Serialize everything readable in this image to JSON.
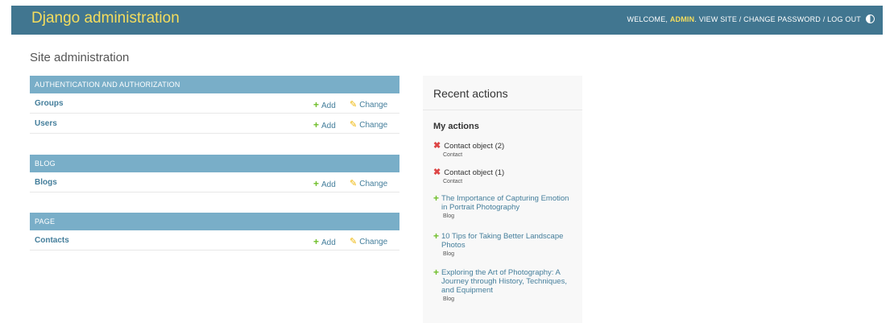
{
  "header": {
    "brand": "Django administration",
    "welcome": "WELCOME,",
    "username": "ADMIN",
    "view_site": "VIEW SITE",
    "change_password": "CHANGE PASSWORD",
    "log_out": "LOG OUT",
    "separator": "/",
    "theme_icon": "theme-toggle-icon"
  },
  "page_title": "Site administration",
  "modules": [
    {
      "caption": "AUTHENTICATION AND AUTHORIZATION",
      "rows": [
        {
          "name": "Groups",
          "add": "Add",
          "change": "Change"
        },
        {
          "name": "Users",
          "add": "Add",
          "change": "Change"
        }
      ]
    },
    {
      "caption": "BLOG",
      "rows": [
        {
          "name": "Blogs",
          "add": "Add",
          "change": "Change"
        }
      ]
    },
    {
      "caption": "PAGE",
      "rows": [
        {
          "name": "Contacts",
          "add": "Add",
          "change": "Change"
        }
      ]
    }
  ],
  "recent": {
    "title": "Recent actions",
    "subtitle": "My actions",
    "actions": [
      {
        "kind": "deletion",
        "icon": "delete-icon",
        "title": "Contact object (2)",
        "type": "Contact"
      },
      {
        "kind": "deletion",
        "icon": "delete-icon",
        "title": "Contact object (1)",
        "type": "Contact"
      },
      {
        "kind": "addition",
        "icon": "add-icon",
        "title": "The Importance of Capturing Emotion in Portrait Photography",
        "type": "Blog"
      },
      {
        "kind": "addition",
        "icon": "add-icon",
        "title": "10 Tips for Taking Better Landscape Photos",
        "type": "Blog"
      },
      {
        "kind": "addition",
        "icon": "add-icon",
        "title": "Exploring the Art of Photography: A Journey through History, Techniques, and Equipment",
        "type": "Blog"
      }
    ]
  },
  "colors": {
    "header_bg": "#417690",
    "brand": "#f5dd5d",
    "module_caption_bg": "#79aec8",
    "link": "#447e9b",
    "add_green": "#70bf2b",
    "change_yellow": "#efb80b",
    "delete_red": "#dd4646"
  }
}
